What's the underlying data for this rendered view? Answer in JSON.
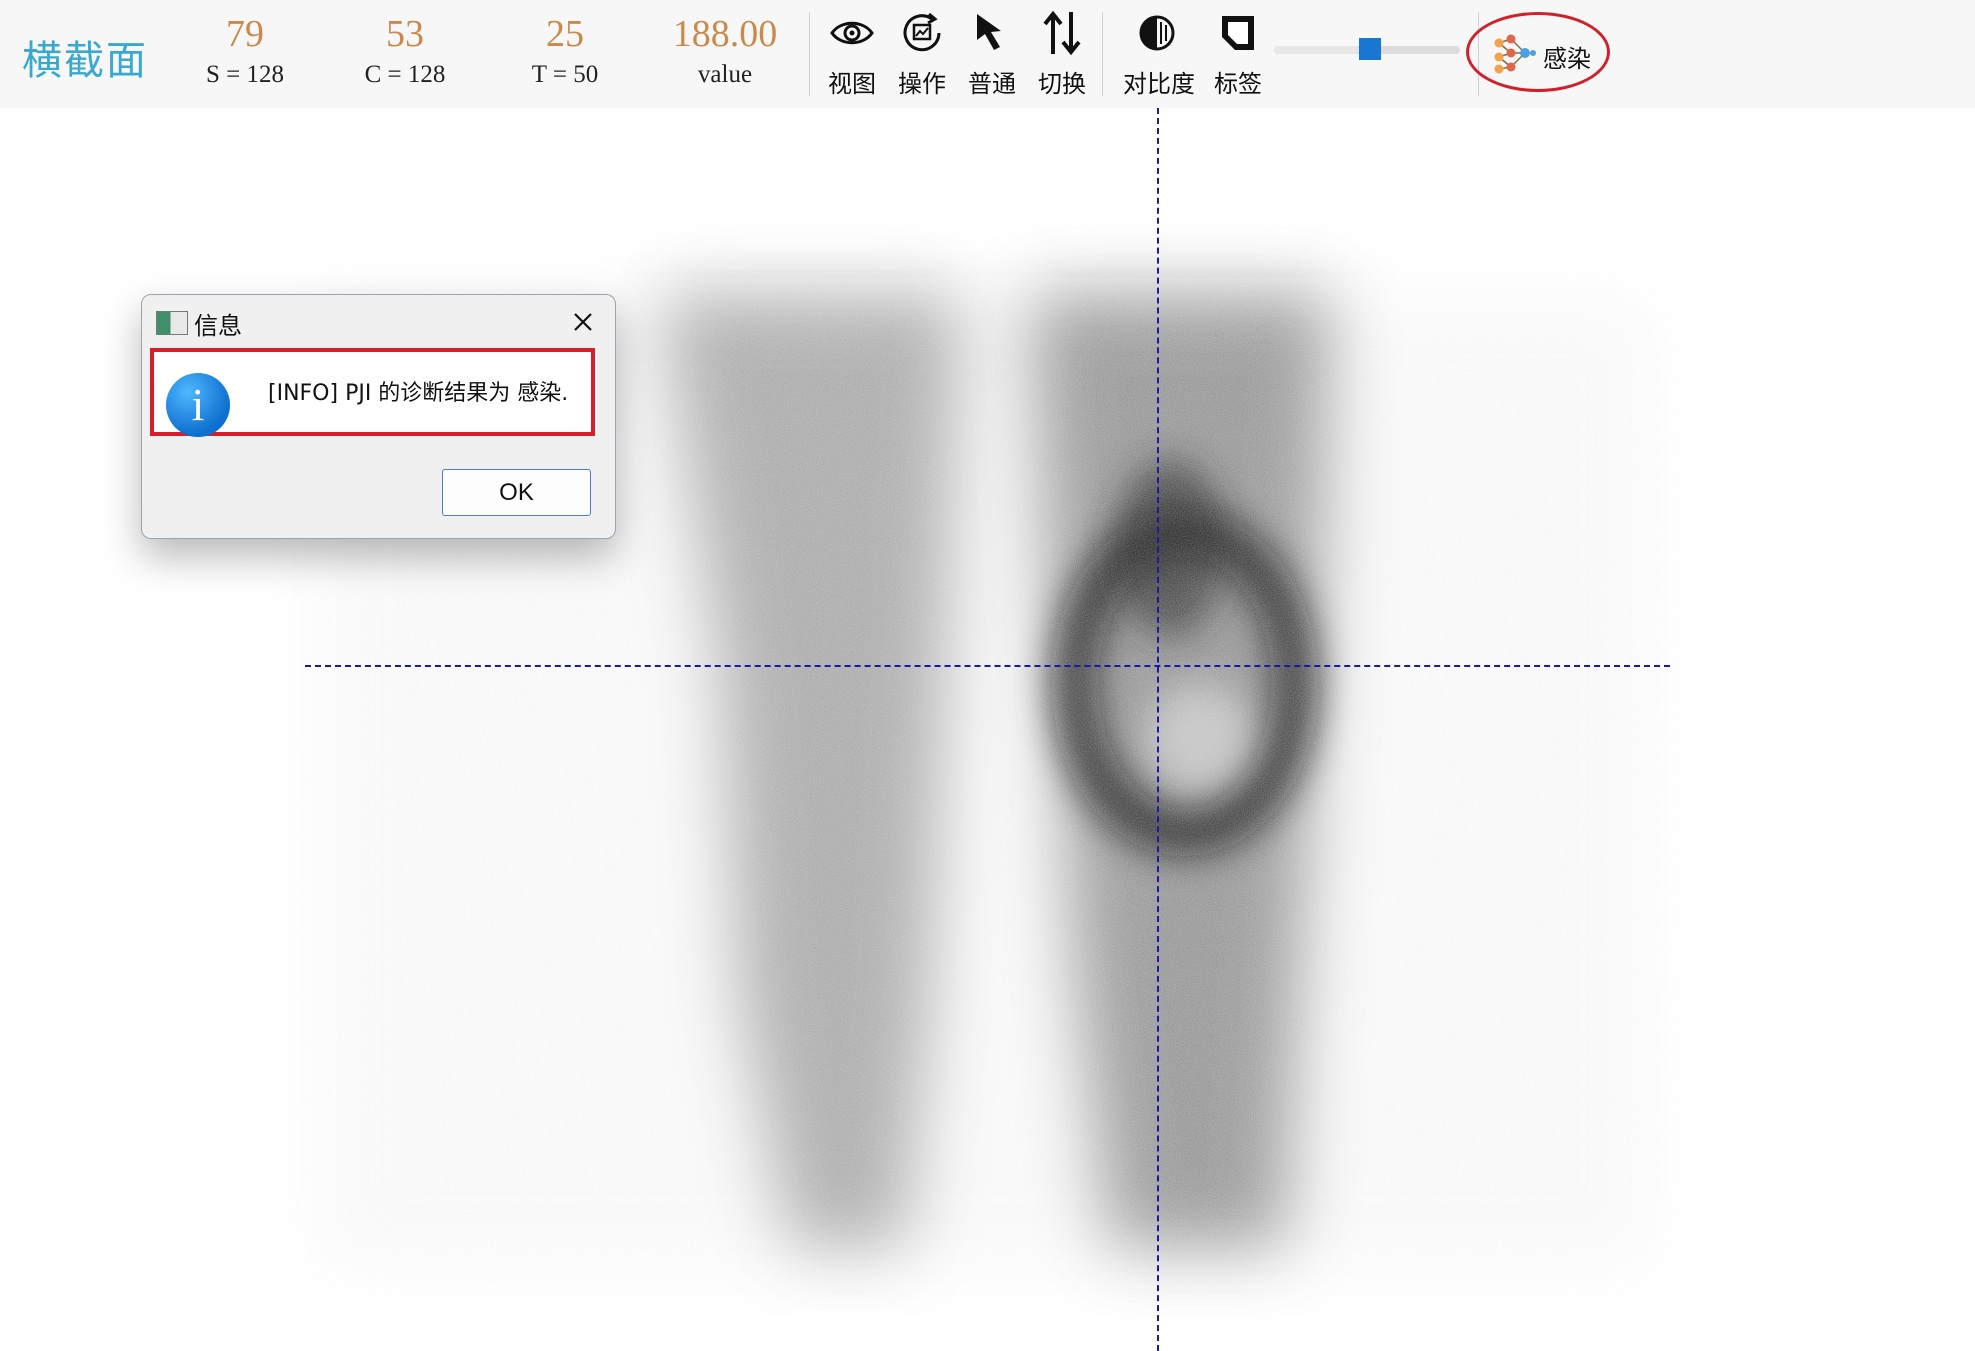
{
  "toolbar": {
    "view_title": "横截面",
    "stats": [
      {
        "value": "79",
        "label": "S = 128"
      },
      {
        "value": "53",
        "label": "C = 128"
      },
      {
        "value": "25",
        "label": "T = 50"
      },
      {
        "value": "188.00",
        "label": "value"
      }
    ],
    "tools": [
      {
        "label": "视图",
        "icon": "eye-icon"
      },
      {
        "label": "操作",
        "icon": "operation-icon"
      },
      {
        "label": "普通",
        "icon": "cursor-arrow-icon"
      },
      {
        "label": "切换",
        "icon": "switch-arrows-icon"
      },
      {
        "label": "对比度",
        "icon": "contrast-icon"
      },
      {
        "label": "标签",
        "icon": "label-icon"
      }
    ],
    "slider_level": 0.52,
    "infection_button": {
      "label": "感染",
      "icon": "network-icon"
    }
  },
  "dialog": {
    "title": "信息",
    "message": "[INFO] PJI 的诊断结果为 感染.",
    "ok_label": "OK"
  },
  "colors": {
    "title": "#3aa9d0",
    "stat_value": "#c98a4b",
    "highlight": "#d61f2b",
    "crosshair": "#1a1aa6",
    "slider_thumb": "#1976d2"
  }
}
